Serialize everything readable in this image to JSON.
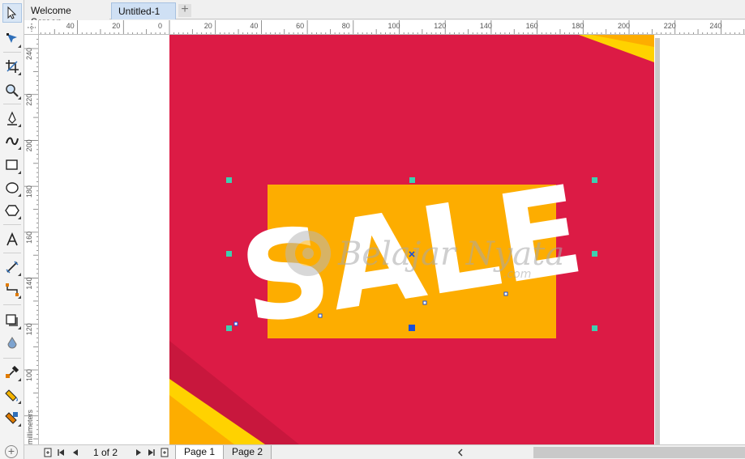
{
  "tabs": {
    "welcome": "Welcome Screen",
    "document": "Untitled-1",
    "add": "+"
  },
  "ruler": {
    "h_labels": [
      "40",
      "20",
      "0",
      "20",
      "40",
      "60",
      "80",
      "100",
      "120",
      "140",
      "160",
      "180",
      "200",
      "220",
      "240"
    ],
    "v_labels": [
      "240",
      "220",
      "200",
      "180",
      "160",
      "140",
      "120",
      "100"
    ],
    "units": "millimeters"
  },
  "toolbox": {
    "tools": [
      "pick-tool-icon",
      "shape-tool-icon",
      "crop-tool-icon",
      "zoom-tool-icon",
      "freehand-tool-icon",
      "artistic-media-icon",
      "rectangle-tool-icon",
      "ellipse-tool-icon",
      "polygon-tool-icon",
      "text-tool-icon",
      "parallel-dimension-icon",
      "connector-tool-icon",
      "drop-shadow-icon",
      "transparency-icon",
      "color-eyedropper-icon",
      "interactive-fill-icon",
      "smart-fill-icon"
    ]
  },
  "design": {
    "headline": "SALE",
    "watermark_brand": "Belajar Nyata",
    "watermark_domain": ".com",
    "colors": {
      "background": "#dc1b45",
      "panel": "#fdad00",
      "accent_yellow": "#ffd200",
      "dark_red": "#c8173d",
      "text": "#ffffff",
      "selection_handle": "#3ecfb0",
      "selection_center": "#1a4fd6"
    }
  },
  "statusbar": {
    "page_count": "1 of 2",
    "page_tabs": [
      "Page 1",
      "Page 2"
    ],
    "zoom_plus": "+"
  }
}
